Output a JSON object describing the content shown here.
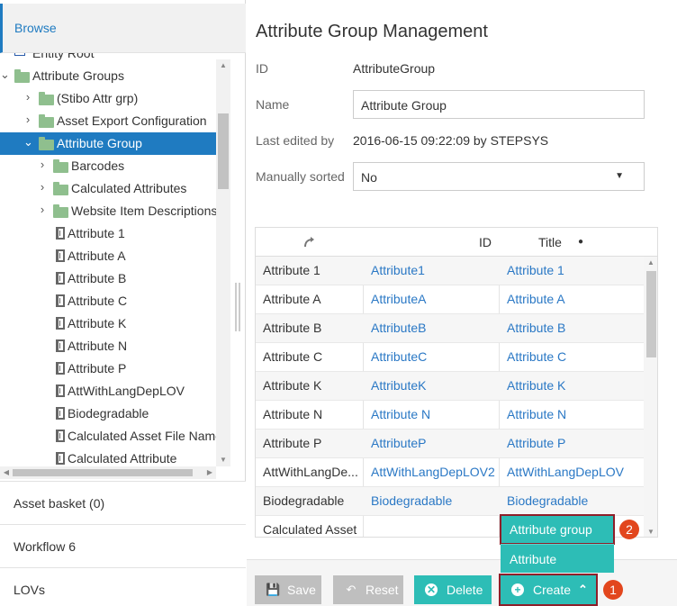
{
  "left": {
    "browse_label": "Browse",
    "tree": [
      {
        "label": "Entity Root",
        "indent": 0,
        "icon": "entity-icon",
        "arrow": ""
      },
      {
        "label": "Attribute Groups",
        "indent": 0,
        "icon": "folder-icon",
        "arrow": "⌄"
      },
      {
        "label": "(Stibo Attr grp)",
        "indent": 1,
        "icon": "folder-icon",
        "arrow": "›"
      },
      {
        "label": "Asset Export Configuration",
        "indent": 1,
        "icon": "folder-icon",
        "arrow": "›"
      },
      {
        "label": "Attribute Group",
        "indent": 1,
        "icon": "folder-icon",
        "arrow": "⌄",
        "selected": true
      },
      {
        "label": "Barcodes",
        "indent": 2,
        "icon": "folder-icon",
        "arrow": "›"
      },
      {
        "label": "Calculated Attributes",
        "indent": 2,
        "icon": "folder-icon",
        "arrow": "›"
      },
      {
        "label": "Website Item Descriptions",
        "indent": 2,
        "icon": "folder-icon",
        "arrow": "›"
      },
      {
        "label": "Attribute 1",
        "indent": 2,
        "icon": "attribute-icon",
        "arrow": ""
      },
      {
        "label": "Attribute A",
        "indent": 2,
        "icon": "attribute-icon",
        "arrow": ""
      },
      {
        "label": "Attribute B",
        "indent": 2,
        "icon": "attribute-icon",
        "arrow": ""
      },
      {
        "label": "Attribute C",
        "indent": 2,
        "icon": "attribute-icon",
        "arrow": ""
      },
      {
        "label": "Attribute K",
        "indent": 2,
        "icon": "attribute-icon",
        "arrow": ""
      },
      {
        "label": "Attribute N",
        "indent": 2,
        "icon": "attribute-icon",
        "arrow": ""
      },
      {
        "label": "Attribute P",
        "indent": 2,
        "icon": "attribute-icon",
        "arrow": ""
      },
      {
        "label": "AttWithLangDepLOV",
        "indent": 2,
        "icon": "attribute-icon",
        "arrow": ""
      },
      {
        "label": "Biodegradable",
        "indent": 2,
        "icon": "attribute-icon",
        "arrow": ""
      },
      {
        "label": "Calculated Asset File Name",
        "indent": 2,
        "icon": "attribute-icon",
        "arrow": ""
      },
      {
        "label": "Calculated Attribute",
        "indent": 2,
        "icon": "attribute-icon",
        "arrow": ""
      }
    ],
    "sections": [
      "Asset basket (0)",
      "Workflow 6",
      "LOVs"
    ]
  },
  "main": {
    "title": "Attribute Group Management",
    "id_label": "ID",
    "id_value": "AttributeGroup",
    "name_label": "Name",
    "name_value": "Attribute Group",
    "edited_label": "Last edited by",
    "edited_value": "2016-06-15 09:22:09 by STEPSYS",
    "sorted_label": "Manually sorted",
    "sorted_value": "No"
  },
  "table": {
    "headers": {
      "c1": "",
      "c2": "ID",
      "c3": "Title"
    },
    "rows": [
      {
        "c1": "Attribute 1",
        "c2": "Attribute1",
        "c3": "Attribute 1"
      },
      {
        "c1": "Attribute A",
        "c2": "AttributeA",
        "c3": "Attribute A"
      },
      {
        "c1": "Attribute B",
        "c2": "AttributeB",
        "c3": "Attribute B"
      },
      {
        "c1": "Attribute C",
        "c2": "AttributeC",
        "c3": "Attribute C"
      },
      {
        "c1": "Attribute K",
        "c2": "AttributeK",
        "c3": "Attribute K"
      },
      {
        "c1": "Attribute N",
        "c2": "Attribute N",
        "c3": "Attribute N"
      },
      {
        "c1": "Attribute P",
        "c2": "AttributeP",
        "c3": "Attribute P"
      },
      {
        "c1": "AttWithLangDe...",
        "c2": "AttWithLangDepLOV2",
        "c3": "AttWithLangDepLOV"
      },
      {
        "c1": "Biodegradable",
        "c2": "Biodegradable",
        "c3": "Biodegradable"
      },
      {
        "c1": "Calculated Asset",
        "c2": "",
        "c3": ""
      }
    ]
  },
  "toolbar": {
    "save": "Save",
    "reset": "Reset",
    "delete": "Delete",
    "create": "Create"
  },
  "menu": {
    "items": [
      "Attribute group",
      "Attribute"
    ]
  },
  "badges": {
    "one": "1",
    "two": "2"
  },
  "colors": {
    "accent": "#1f7bc1",
    "teal": "#2dbdb6",
    "highlight": "#8e1f2a",
    "badge": "#e2461d"
  }
}
